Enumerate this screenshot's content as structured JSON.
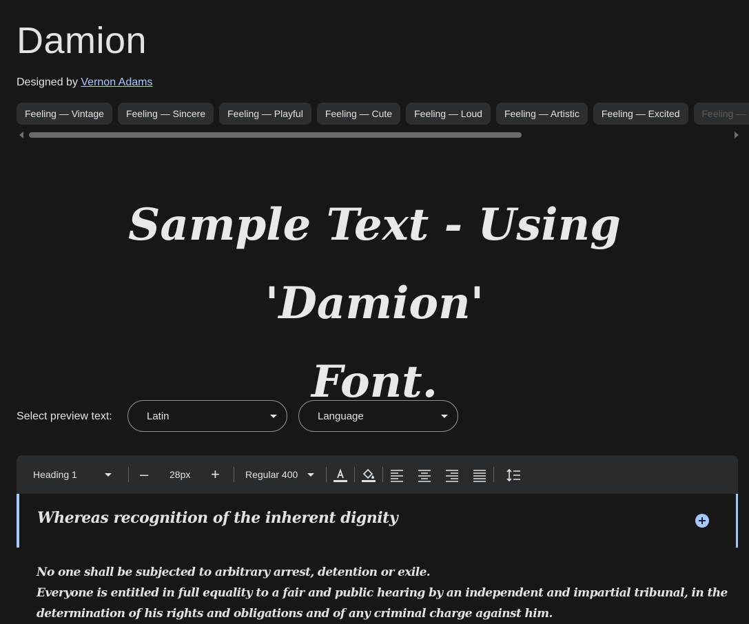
{
  "header": {
    "title": "Damion",
    "designed_by_prefix": "Designed by ",
    "designer": "Vernon Adams"
  },
  "chips": [
    "Feeling — Vintage",
    "Feeling — Sincere",
    "Feeling — Playful",
    "Feeling — Cute",
    "Feeling — Loud",
    "Feeling — Artistic",
    "Feeling — Excited",
    "Feeling — Happy"
  ],
  "sample": {
    "line1": "Sample Text - Using 'Damion'",
    "line2": "Font."
  },
  "preview_controls": {
    "label": "Select preview text:",
    "script_value": "Latin",
    "language_placeholder": "Language"
  },
  "toolbar": {
    "style": "Heading 1",
    "size": "28px",
    "weight": "Regular 400",
    "decrease": "–",
    "increase": "+"
  },
  "preview": {
    "heading": "Whereas recognition of the inherent dignity",
    "lines": [
      "No one shall be subjected to arbitrary arrest, detention or exile.",
      "Everyone is entitled in full equality to a fair and public hearing by an independent and impartial tribunal, in the",
      "determination of his rights and obligations and of any criminal charge against him."
    ]
  },
  "colors": {
    "background": "#171717",
    "accent": "#a8c7fa",
    "chip": "#2d2e30",
    "toolbar": "#2a2b2d"
  }
}
